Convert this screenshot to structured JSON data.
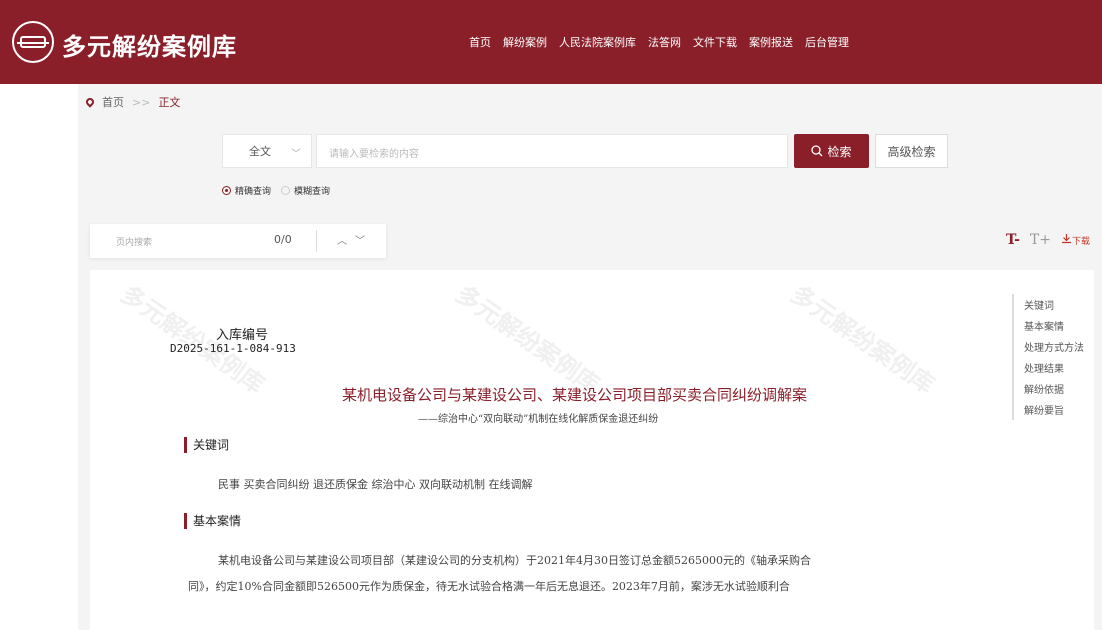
{
  "header": {
    "site_name": "多元解纷案例库",
    "nav": [
      "首页",
      "解纷案例",
      "人民法院案例库",
      "法答网",
      "文件下载",
      "案例报送",
      "后台管理"
    ]
  },
  "breadcrumb": {
    "home": "首页",
    "separator": ">>",
    "current": "正文"
  },
  "search": {
    "scope_selected": "全文",
    "placeholder": "请输入要检索的内容",
    "search_button": "检索",
    "advanced_button": "高级检索",
    "mode_exact": "精确查询",
    "mode_fuzzy": "模糊查询",
    "mode_selected": "exact"
  },
  "find_in_page": {
    "placeholder": "页内搜索",
    "count": "0/0"
  },
  "tools": {
    "decrease_font": "T-",
    "increase_font": "T+",
    "download": "下载"
  },
  "document": {
    "watermark": "多元解纷案例库",
    "entry_label": "入库编号",
    "entry_number": "D2025-161-1-084-913",
    "title": "某机电设备公司与某建设公司、某建设公司项目部买卖合同纠纷调解案",
    "subtitle": "——综治中心“双向联动”机制在线化解质保金退还纠纷",
    "sections": [
      {
        "heading": "关键词",
        "lines": [
          "民事 买卖合同纠纷 退还质保金 综治中心 双向联动机制 在线调解"
        ]
      },
      {
        "heading": "基本案情",
        "lines": [
          "某机电设备公司与某建设公司项目部（某建设公司的分支机构）于2021年4月30日签订总金额5265000元的《轴承采购合",
          "同》，约定10%合同金额即526500元作为质保金，待无水试验合格满一年后无息退还。2023年7月前，案涉无水试验顺利合"
        ]
      }
    ],
    "outline": [
      "关键词",
      "基本案情",
      "处理方式方法",
      "处理结果",
      "解纷依据",
      "解纷要旨"
    ]
  },
  "colors": {
    "brand": "#8a1f2a"
  }
}
